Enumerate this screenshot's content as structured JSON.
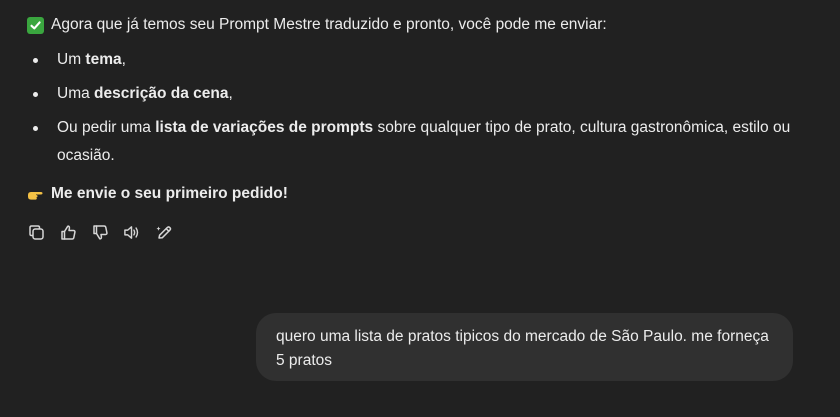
{
  "assistant": {
    "intro_text": "Agora que já temos seu Prompt Mestre traduzido e pronto, você pode me enviar:",
    "items": [
      {
        "prefix": "Um ",
        "bold": "tema",
        "suffix": ","
      },
      {
        "prefix": "Uma ",
        "bold": "descrição da cena",
        "suffix": ","
      },
      {
        "prefix": "Ou pedir uma ",
        "bold": "lista de variações de prompts",
        "suffix": " sobre qualquer tipo de prato, cultura gastronômica, estilo ou ocasião."
      }
    ],
    "cta_text": "Me envie o seu primeiro pedido!",
    "actions": [
      {
        "name": "copy-icon"
      },
      {
        "name": "thumbs-up-icon"
      },
      {
        "name": "thumbs-down-icon"
      },
      {
        "name": "read-aloud-icon"
      },
      {
        "name": "edit-in-canvas-icon"
      }
    ]
  },
  "user": {
    "message": "quero uma lista de pratos tipicos do mercado de São Paulo. me forneça 5 pratos"
  },
  "colors": {
    "background": "#212121",
    "bubble": "#303030",
    "text": "#ececec",
    "check": "#3aa63f",
    "hand": "#f4c145"
  }
}
